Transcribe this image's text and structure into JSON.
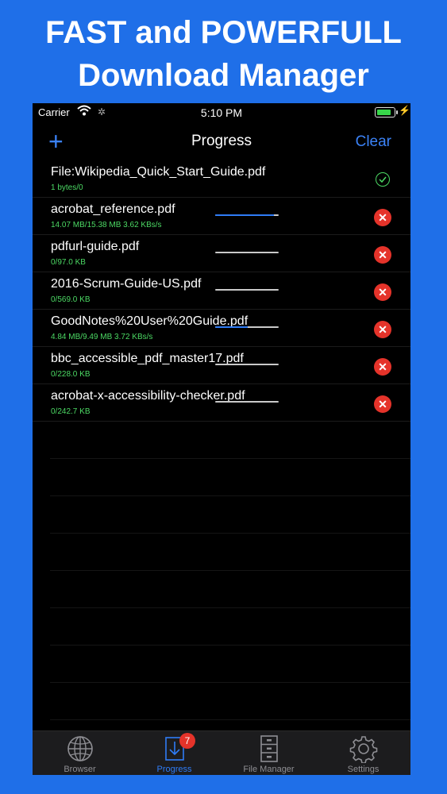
{
  "promo": {
    "line1": "FAST and POWERFULL",
    "line2": "Download Manager"
  },
  "status": {
    "carrier": "Carrier",
    "time": "5:10 PM"
  },
  "nav": {
    "title": "Progress",
    "clear_label": "Clear"
  },
  "downloads": [
    {
      "name": "File:Wikipedia_Quick_Start_Guide.pdf",
      "stat": "1 bytes/0",
      "state": "done",
      "progress": null
    },
    {
      "name": "acrobat_reference.pdf",
      "stat": "14.07 MB/15.38 MB  3.62 KBs/s",
      "state": "downloading",
      "progress": 0.92
    },
    {
      "name": "pdfurl-guide.pdf",
      "stat": "0/97.0 KB",
      "state": "downloading",
      "progress": 0
    },
    {
      "name": "2016-Scrum-Guide-US.pdf",
      "stat": "0/569.0 KB",
      "state": "downloading",
      "progress": 0
    },
    {
      "name": "GoodNotes%20User%20Guide.pdf",
      "stat": "4.84 MB/9.49 MB  3.72 KBs/s",
      "state": "downloading",
      "progress": 0.51
    },
    {
      "name": "bbc_accessible_pdf_master17.pdf",
      "stat": "0/228.0 KB",
      "state": "downloading",
      "progress": 0
    },
    {
      "name": "acrobat-x-accessibility-checker.pdf",
      "stat": "0/242.7 KB",
      "state": "downloading",
      "progress": 0
    }
  ],
  "tabs": {
    "browser": "Browser",
    "progress": "Progress",
    "progress_badge": "7",
    "file_manager": "File Manager",
    "settings": "Settings"
  },
  "colors": {
    "accent": "#2f7cf6",
    "success": "#4cd964",
    "danger": "#e5332a",
    "background": "#1f6fe8"
  }
}
